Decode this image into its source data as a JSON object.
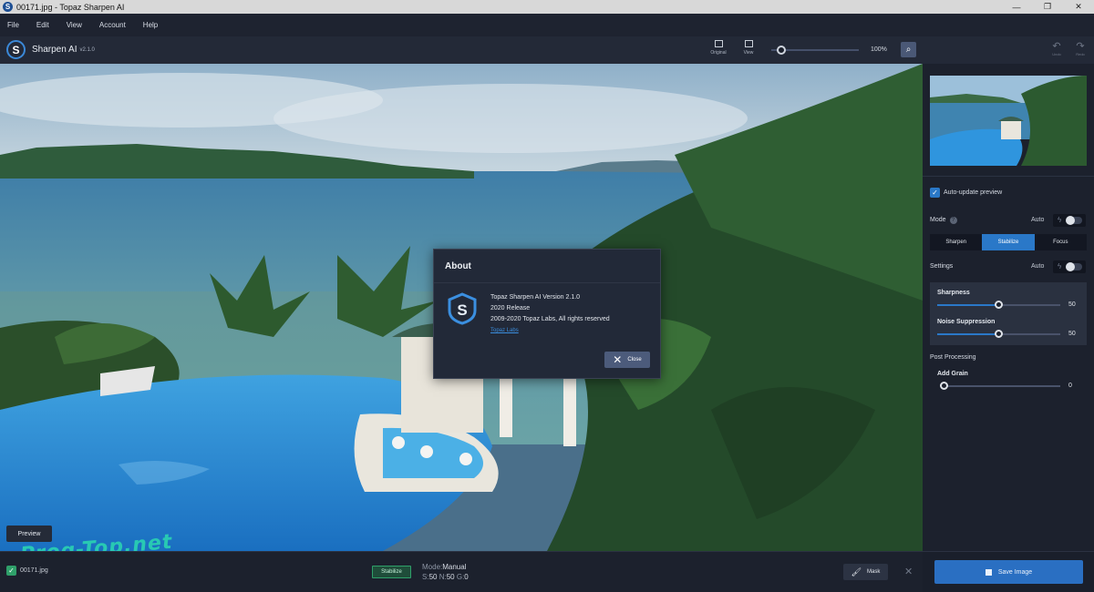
{
  "window": {
    "title": "00171.jpg - Topaz Sharpen AI",
    "controls": [
      "—",
      "❐",
      "✕"
    ]
  },
  "menu": [
    "File",
    "Edit",
    "View",
    "Account",
    "Help"
  ],
  "toolbar": {
    "app_name": "Sharpen AI",
    "version": "v2.1.0",
    "original_label": "Original",
    "view_label": "View",
    "zoom": "100%",
    "undo_label": "Undo",
    "redo_label": "Redo",
    "zoom_slider_level": 0.06
  },
  "about": {
    "title": "About",
    "line1": "Topaz Sharpen AI Version 2.1.0",
    "line2": "2020 Release",
    "line3": "2009-2020 Topaz Labs, All rights reserved",
    "link": "Topaz Labs",
    "close_label": "Close"
  },
  "panel": {
    "auto_update_label": "Auto-update preview",
    "mode_label": "Mode",
    "auto_label": "Auto",
    "modes": [
      "Sharpen",
      "Stabilize",
      "Focus"
    ],
    "active_mode": "Stabilize",
    "settings_label": "Settings",
    "sharpness": {
      "label": "Sharpness",
      "value": "50"
    },
    "noise": {
      "label": "Noise Suppression",
      "value": "50"
    },
    "post_processing_label": "Post Processing",
    "grain": {
      "label": "Add Grain",
      "value": "0"
    },
    "save_label": "Save Image"
  },
  "photo": {
    "preview_label": "Preview",
    "watermark": "Prog-Top.net"
  },
  "bottom": {
    "filename": "00171.jpg",
    "badge": "Stabilize",
    "mode_prefix": "Mode:",
    "mode_value": "Manual",
    "s_label": "S:",
    "s_value": "50",
    "n_label": "N:",
    "n_value": "50",
    "g_label": "G:",
    "g_value": "0",
    "mask_label": "Mask"
  },
  "colors": {
    "accent": "#2a78c8",
    "badge": "#2fa06a",
    "watermark": "#2bd9b1"
  }
}
